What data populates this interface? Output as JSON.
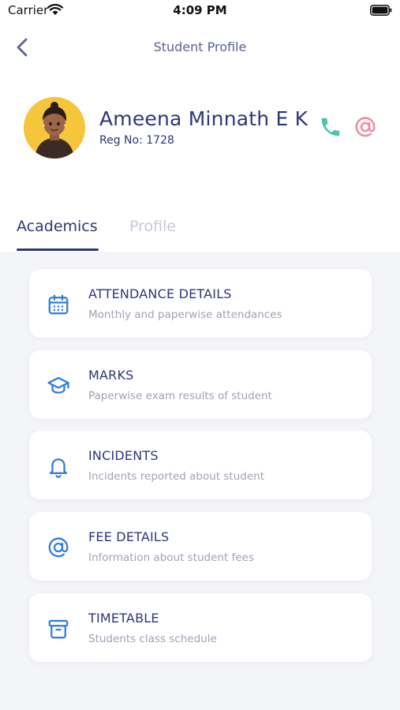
{
  "status_bar": {
    "carrier": "Carrier",
    "time": "4:09 PM"
  },
  "nav": {
    "title": "Student Profile"
  },
  "student": {
    "name": "Ameena Minnath E K",
    "reg_no": "Reg No: 1728"
  },
  "tabs": [
    {
      "label": "Academics",
      "active": true
    },
    {
      "label": "Profile",
      "active": false
    }
  ],
  "colors": {
    "primary": "#2f3877",
    "accent_blue": "#2f7be0",
    "call": "#4cc3b1",
    "email": "#f08aa0",
    "avatar_bg": "#f5c63b"
  },
  "cards": [
    {
      "title": "ATTENDANCE DETAILS",
      "subtitle": "Monthly and paperwise attendances",
      "icon": "calendar-icon"
    },
    {
      "title": "MARKS",
      "subtitle": "Paperwise exam results of student",
      "icon": "graduation-cap-icon"
    },
    {
      "title": "INCIDENTS",
      "subtitle": "Incidents reported about student",
      "icon": "bell-icon"
    },
    {
      "title": "FEE DETAILS",
      "subtitle": "Information about student fees",
      "icon": "at-sign-icon"
    },
    {
      "title": "TIMETABLE",
      "subtitle": "Students class schedule",
      "icon": "archive-box-icon"
    }
  ]
}
